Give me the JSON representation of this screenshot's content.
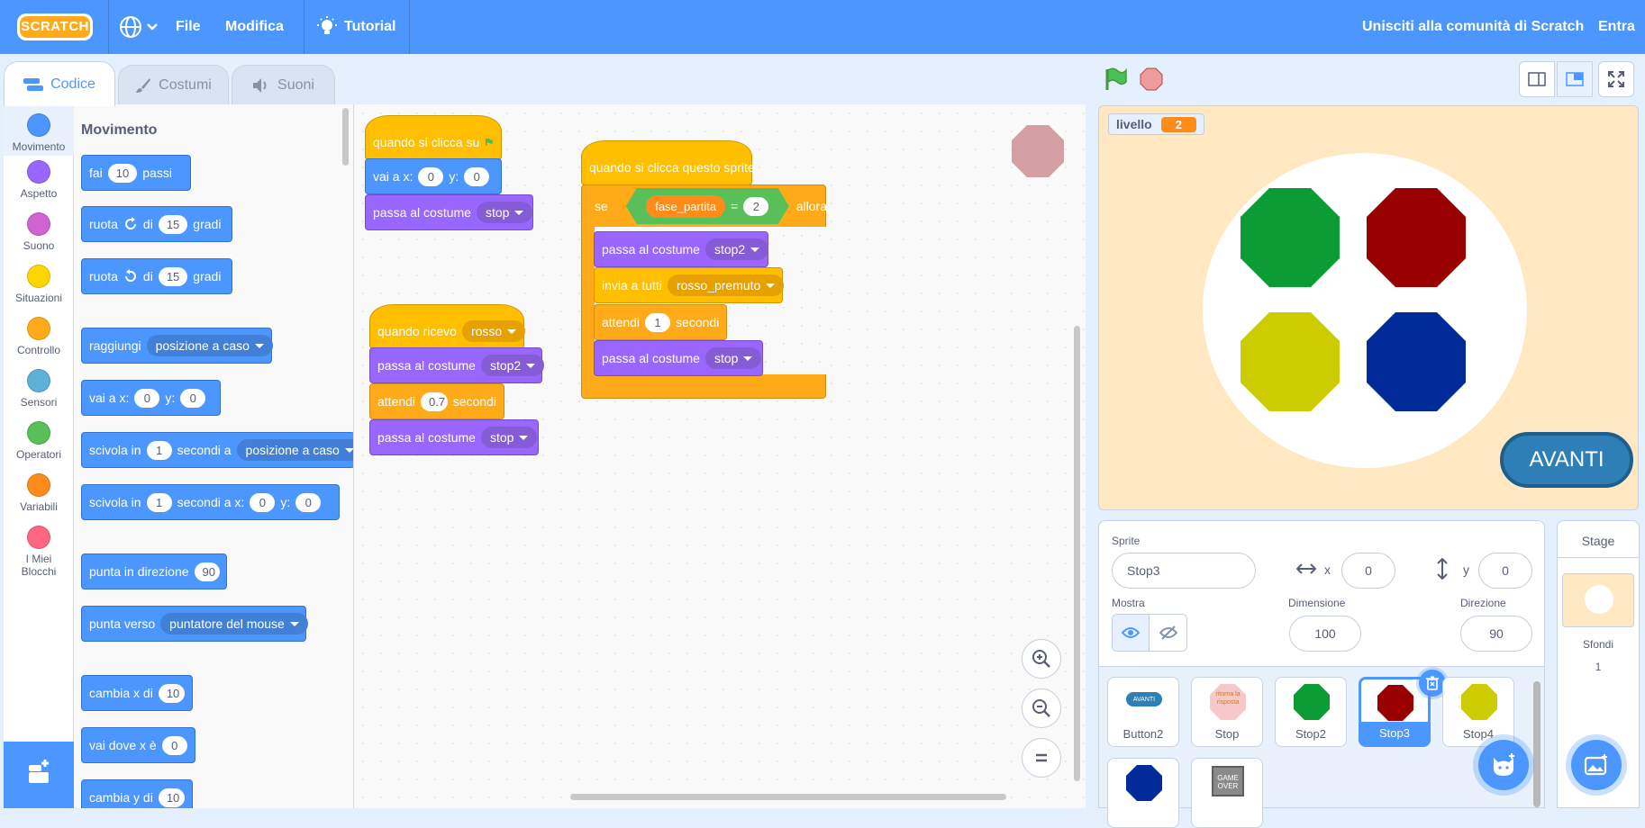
{
  "topbar": {
    "logo": "SCRATCH",
    "file": "File",
    "edit": "Modifica",
    "tutorial": "Tutorial",
    "join": "Unisciti alla comunità di Scratch",
    "signin": "Entra"
  },
  "tabs": {
    "code": "Codice",
    "costumes": "Costumi",
    "sounds": "Suoni"
  },
  "categories": [
    {
      "label": "Movimento",
      "color": "#4c97ff"
    },
    {
      "label": "Aspetto",
      "color": "#9966ff"
    },
    {
      "label": "Suono",
      "color": "#cf63cf"
    },
    {
      "label": "Situazioni",
      "color": "#ffd500"
    },
    {
      "label": "Controllo",
      "color": "#ffab19"
    },
    {
      "label": "Sensori",
      "color": "#5cb1d6"
    },
    {
      "label": "Operatori",
      "color": "#59c059"
    },
    {
      "label": "Variabili",
      "color": "#ff8c1a"
    },
    {
      "label": "I Miei Blocchi",
      "color": "#ff6680"
    }
  ],
  "palette": {
    "title": "Movimento",
    "move": {
      "a": "fai",
      "n": "10",
      "b": "passi"
    },
    "turn_right": {
      "a": "ruota",
      "b": "di",
      "n": "15",
      "c": "gradi"
    },
    "turn_left": {
      "a": "ruota",
      "b": "di",
      "n": "15",
      "c": "gradi"
    },
    "goto": {
      "a": "raggiungi",
      "dd": "posizione a caso"
    },
    "goto_xy": {
      "a": "vai a x:",
      "x": "0",
      "b": "y:",
      "y": "0"
    },
    "glide": {
      "a": "scivola in",
      "n": "1",
      "b": "secondi a",
      "dd": "posizione a caso"
    },
    "glide_xy": {
      "a": "scivola in",
      "n": "1",
      "b": "secondi a x:",
      "x": "0",
      "c": "y:",
      "y": "0"
    },
    "point_dir": {
      "a": "punta in direzione",
      "n": "90"
    },
    "point_to": {
      "a": "punta verso",
      "dd": "puntatore del mouse"
    },
    "change_x": {
      "a": "cambia x di",
      "n": "10"
    },
    "set_x": {
      "a": "vai dove x è",
      "n": "0"
    },
    "change_y": {
      "a": "cambia y di",
      "n": "10"
    }
  },
  "script1": {
    "hat": "quando si clicca su",
    "goto": {
      "a": "vai a x:",
      "x": "0",
      "b": "y:",
      "y": "0"
    },
    "costume": {
      "a": "passa al costume",
      "dd": "stop"
    }
  },
  "script2": {
    "hat": {
      "a": "quando ricevo",
      "dd": "rosso"
    },
    "costume1": {
      "a": "passa al costume",
      "dd": "stop2"
    },
    "wait": {
      "a": "attendi",
      "n": "0.7",
      "b": "secondi"
    },
    "costume2": {
      "a": "passa al costume",
      "dd": "stop"
    }
  },
  "script3": {
    "hat": "quando si clicca questo sprite",
    "if": {
      "a": "se",
      "var": "fase_partita",
      "op": "=",
      "n": "2",
      "b": "allora"
    },
    "costume1": {
      "a": "passa al costume",
      "dd": "stop2"
    },
    "broadcast": {
      "a": "invia a tutti",
      "dd": "rosso_premuto"
    },
    "wait": {
      "a": "attendi",
      "n": "1",
      "b": "secondi"
    },
    "costume2": {
      "a": "passa al costume",
      "dd": "stop"
    }
  },
  "stage": {
    "monitor_name": "livello",
    "monitor_value": "2",
    "button": "AVANTI"
  },
  "sprite_info": {
    "sprite_label": "Sprite",
    "sprite_name": "Stop3",
    "x_label": "x",
    "x": "0",
    "y_label": "y",
    "y": "0",
    "show_label": "Mostra",
    "size_label": "Dimensione",
    "size": "100",
    "dir_label": "Direzione",
    "dir": "90"
  },
  "sprites": [
    "Button2",
    "Stop",
    "Stop2",
    "Stop3",
    "Stop4"
  ],
  "thumb_texts": {
    "button2": "AVANTI",
    "stop": "ritorna la risposta",
    "game_over": "GAME OVER"
  },
  "stage_panel": {
    "title": "Stage",
    "backdrops_label": "Sfondi",
    "backdrops_count": "1"
  }
}
